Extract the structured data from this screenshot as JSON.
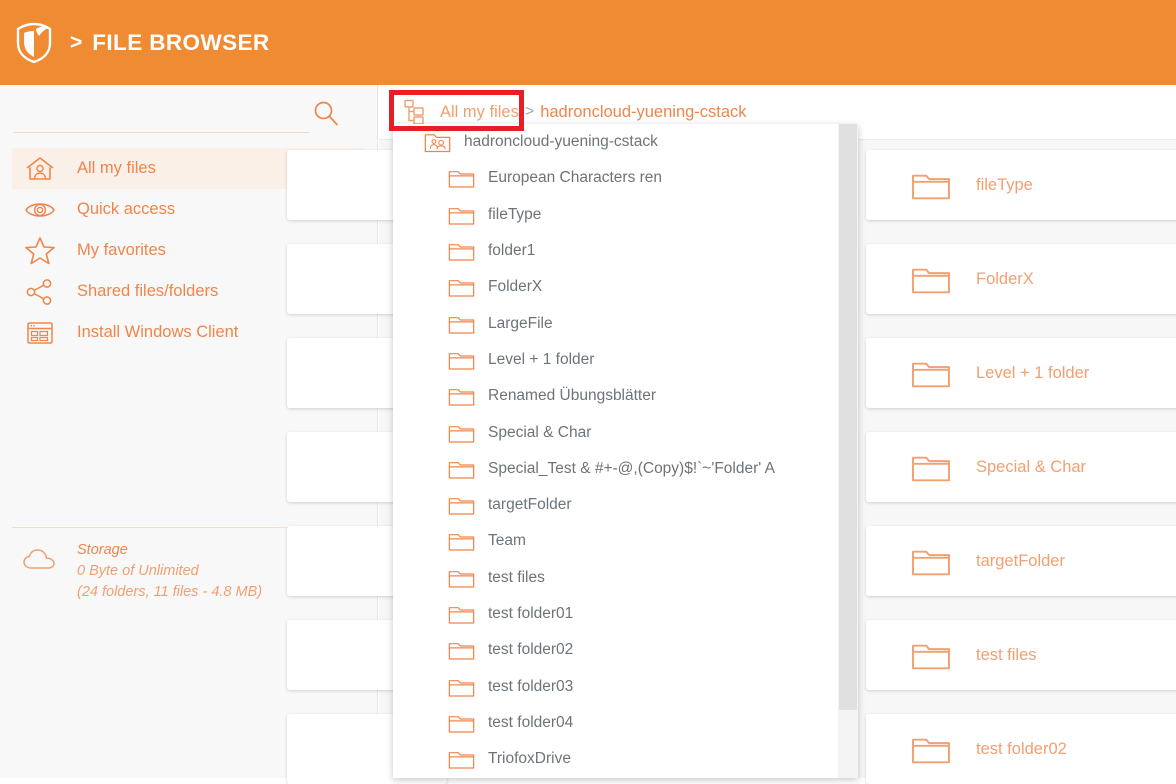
{
  "header": {
    "logo_icon": "shield-logo-icon",
    "separator": ">",
    "title": "FILE BROWSER",
    "background_color": "#ee8b33"
  },
  "sidebar": {
    "search": {
      "value": "",
      "placeholder": "",
      "icon": "search-icon"
    },
    "items": [
      {
        "label": "All my files",
        "icon": "home-user-icon",
        "active": true
      },
      {
        "label": "Quick access",
        "icon": "eye-icon",
        "active": false
      },
      {
        "label": "My favorites",
        "icon": "star-icon",
        "active": false
      },
      {
        "label": "Shared files/folders",
        "icon": "share-nodes-icon",
        "active": false
      },
      {
        "label": "Install Windows Client",
        "icon": "window-app-icon",
        "active": false
      }
    ],
    "storage": {
      "icon": "cloud-icon",
      "title": "Storage",
      "usage": "0 Byte of Unlimited",
      "details": "(24 folders, 11 files - 4.8 MB)"
    }
  },
  "breadcrumb": {
    "tree_icon": "folder-tree-icon",
    "root_label": "All my files",
    "separator": ">",
    "current_label": "hadroncloud-yuening-cstack"
  },
  "tree_dropdown": {
    "root": {
      "label": "hadroncloud-yuening-cstack",
      "icon": "shared-folder-icon"
    },
    "children": [
      {
        "label": "European Characters ren",
        "icon": "folder-icon"
      },
      {
        "label": "fileType",
        "icon": "folder-icon"
      },
      {
        "label": "folder1",
        "icon": "folder-icon"
      },
      {
        "label": "FolderX",
        "icon": "folder-icon"
      },
      {
        "label": "LargeFile",
        "icon": "folder-icon"
      },
      {
        "label": "Level + 1 folder",
        "icon": "folder-icon"
      },
      {
        "label": "Renamed Übungsblätter",
        "icon": "folder-icon"
      },
      {
        "label": "Special & Char",
        "icon": "folder-icon"
      },
      {
        "label": "Special_Test & #+-@,(Copy)$!`~'Folder' A",
        "icon": "folder-icon"
      },
      {
        "label": "targetFolder",
        "icon": "folder-icon"
      },
      {
        "label": "Team",
        "icon": "folder-icon"
      },
      {
        "label": "test files",
        "icon": "folder-icon"
      },
      {
        "label": "test folder01",
        "icon": "folder-icon"
      },
      {
        "label": "test folder02",
        "icon": "folder-icon"
      },
      {
        "label": "test folder03",
        "icon": "folder-icon"
      },
      {
        "label": "test folder04",
        "icon": "folder-icon"
      },
      {
        "label": "TriofoxDrive",
        "icon": "folder-icon"
      }
    ]
  },
  "file_cards": [
    {
      "label": "fileType",
      "icon": "folder-icon"
    },
    {
      "label": "FolderX",
      "icon": "folder-icon"
    },
    {
      "label": "Level + 1 folder",
      "icon": "folder-icon"
    },
    {
      "label": "Special & Char",
      "icon": "folder-icon"
    },
    {
      "label": "targetFolder",
      "icon": "folder-icon"
    },
    {
      "label": "test files",
      "icon": "folder-icon"
    },
    {
      "label": "test folder02",
      "icon": "folder-icon"
    }
  ],
  "annotation": {
    "type": "highlight-rectangle",
    "color": "#e81e25",
    "target": "All my files breadcrumb root"
  },
  "colors": {
    "header_orange": "#ee8b33",
    "accent_orange": "#f0854a",
    "light_orange": "#f2a072",
    "tree_text": "#6d7479",
    "sidebar_bg": "#f8f8f8",
    "main_bg": "#f7f7f7",
    "highlight_red": "#e81e25"
  }
}
